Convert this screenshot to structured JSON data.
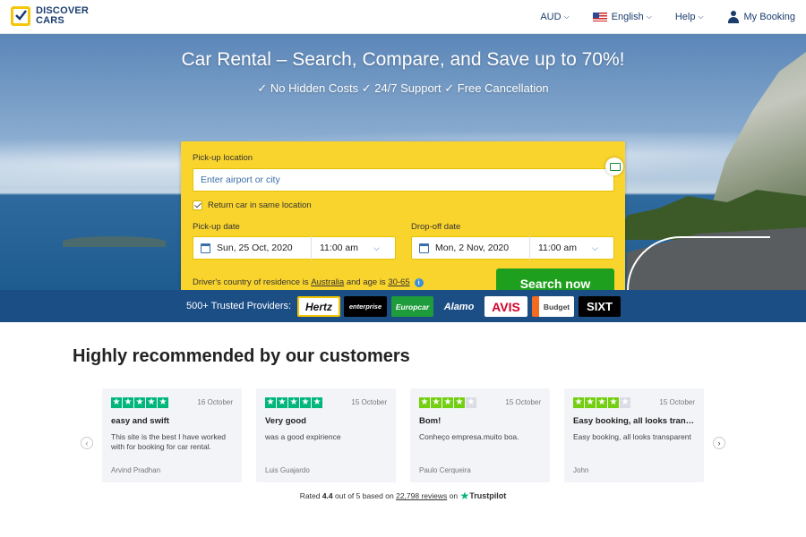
{
  "header": {
    "logo_line1": "DISCOVER",
    "logo_line2": "CARS",
    "currency": "AUD",
    "language": "English",
    "help": "Help",
    "my_booking": "My Booking"
  },
  "hero": {
    "title": "Car Rental – Search, Compare, and Save up to 70%!",
    "subtitle": "✓ No Hidden Costs ✓ 24/7 Support ✓ Free Cancellation"
  },
  "search": {
    "pickup_location_label": "Pick-up location",
    "pickup_location_placeholder": "Enter airport or city",
    "return_same_label": "Return car in same location",
    "return_same_checked": true,
    "pickup_date_label": "Pick-up date",
    "pickup_date": "Sun, 25 Oct, 2020",
    "pickup_time": "11:00 am",
    "dropoff_date_label": "Drop-off date",
    "dropoff_date": "Mon, 2 Nov, 2020",
    "dropoff_time": "11:00 am",
    "residence_prefix": "Driver's country of residence is",
    "residence_country": "Australia",
    "residence_mid": "and age is",
    "residence_age": "30-65",
    "search_button": "Search now"
  },
  "providers": {
    "label": "500+ Trusted Providers:",
    "logos": [
      "Hertz",
      "enterprise",
      "Europcar",
      "Alamo",
      "AVIS",
      "Budget",
      "SIXT"
    ]
  },
  "reviews": {
    "title": "Highly recommended by our customers",
    "items": [
      {
        "stars": 5,
        "date": "16 October",
        "title": "easy and swift",
        "body": "This site is the best I have worked with for booking for car rental.",
        "author": "Arvind Pradhan"
      },
      {
        "stars": 5,
        "date": "15 October",
        "title": "Very good",
        "body": "was a good expirience",
        "author": "Luis Guajardo"
      },
      {
        "stars": 4,
        "date": "15 October",
        "title": "Bom!",
        "body": "Conheço empresa.muito boa.",
        "author": "Paulo Cerqueira"
      },
      {
        "stars": 4,
        "date": "15 October",
        "title": "Easy booking, all looks transp...",
        "body": "Easy booking, all looks transparent",
        "author": "John"
      }
    ],
    "rated_prefix": "Rated",
    "rating": "4.4",
    "rated_mid": "out of 5 based on",
    "review_count": "22,798 reviews",
    "rated_on": "on",
    "trustpilot": "Trustpilot"
  },
  "colors": {
    "brand_navy": "#1b3d6e",
    "search_yellow": "#f9d42c",
    "search_green": "#1ea01e",
    "providers_blue": "#1c4e86",
    "trustpilot_green": "#00b67a"
  }
}
